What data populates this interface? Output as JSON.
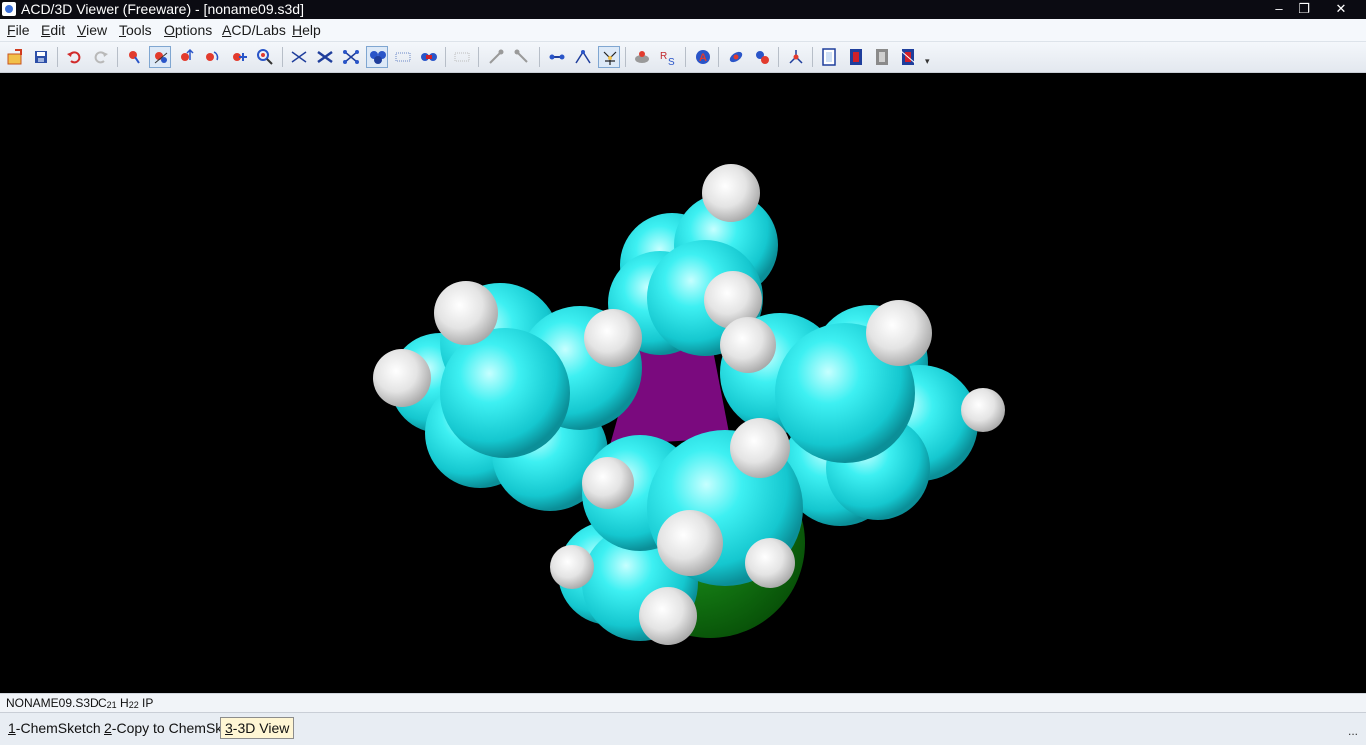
{
  "window": {
    "title": "ACD/3D Viewer (Freeware) - [noname09.s3d]",
    "minimize_glyph": "‒",
    "restore_glyph": "❐",
    "close_glyph": "✕"
  },
  "menu": {
    "items": [
      {
        "accel": "F",
        "rest": "ile"
      },
      {
        "accel": "E",
        "rest": "dit"
      },
      {
        "accel": "V",
        "rest": "iew"
      },
      {
        "accel": "T",
        "rest": "ools"
      },
      {
        "accel": "O",
        "rest": "ptions"
      },
      {
        "accel": "A",
        "rest": "CD/Labs"
      },
      {
        "accel": "H",
        "rest": "elp"
      }
    ]
  },
  "toolbar": {
    "overflow_glyph": "▾",
    "icons": [
      "open-icon",
      "save-icon",
      "undo-icon",
      "redo-icon",
      "rotate-icon",
      "rotate-z-icon",
      "move-icon",
      "zoom-icon",
      "add-atom-icon",
      "zoom-window-icon",
      "wireframe-icon",
      "sticks-icon",
      "ball-stick-icon",
      "spacefill-icon",
      "dots-icon",
      "dots-spacefill-icon",
      "grayed-icon",
      "measure-icon",
      "probe-icon",
      "bond-length-icon",
      "angle-icon",
      "torsion-icon",
      "hydrogens-icon",
      "rs-label-icon",
      "atom-label-icon",
      "color-icon",
      "orbital-icon",
      "fragment-icon",
      "frame-icon",
      "movie-icon",
      "movie-gray-icon",
      "movie-edit-icon"
    ],
    "active": [
      "rotate-z-icon",
      "spacefill-icon",
      "torsion-icon"
    ]
  },
  "status": {
    "file_name": "NONAME09.S3D",
    "formula_parts": [
      {
        "text": "C",
        "sub": "21"
      },
      {
        "text": " H",
        "sub": "22"
      },
      {
        "text": " IP",
        "sub": ""
      }
    ]
  },
  "tasks": [
    {
      "accel": "1",
      "rest": "-ChemSketch",
      "active": false
    },
    {
      "accel": "2",
      "rest": "-Copy to ChemSk",
      "active": false
    },
    {
      "accel": "3",
      "rest": "-3D View",
      "active": true
    }
  ],
  "more_glyph": "...",
  "colors": {
    "carbon": "#22e4e8",
    "hydrogen": "#f2f2f2",
    "iodine": "#7a0a7e",
    "phosphorus": "#0e6e0e",
    "background": "#000000"
  }
}
